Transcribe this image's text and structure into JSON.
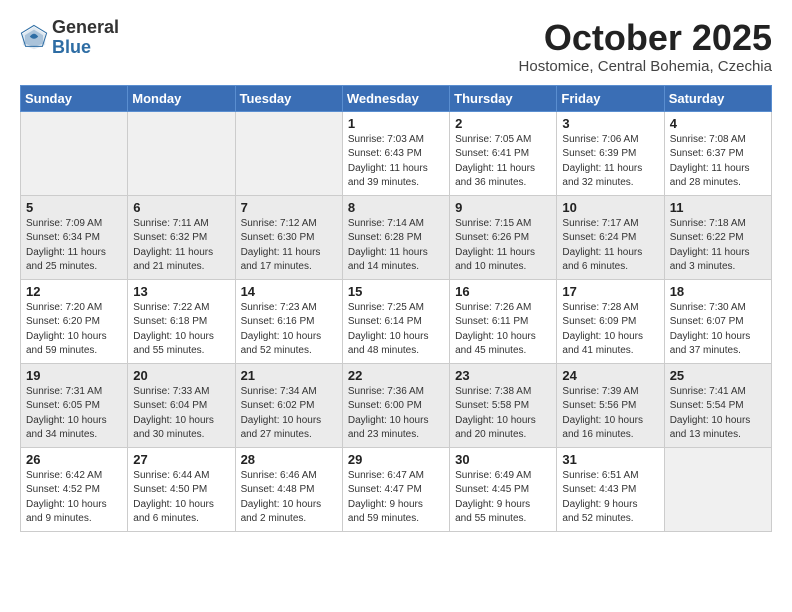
{
  "logo": {
    "general": "General",
    "blue": "Blue"
  },
  "title": "October 2025",
  "location": "Hostomice, Central Bohemia, Czechia",
  "days_header": [
    "Sunday",
    "Monday",
    "Tuesday",
    "Wednesday",
    "Thursday",
    "Friday",
    "Saturday"
  ],
  "weeks": [
    [
      {
        "day": "",
        "info": ""
      },
      {
        "day": "",
        "info": ""
      },
      {
        "day": "",
        "info": ""
      },
      {
        "day": "1",
        "info": "Sunrise: 7:03 AM\nSunset: 6:43 PM\nDaylight: 11 hours\nand 39 minutes."
      },
      {
        "day": "2",
        "info": "Sunrise: 7:05 AM\nSunset: 6:41 PM\nDaylight: 11 hours\nand 36 minutes."
      },
      {
        "day": "3",
        "info": "Sunrise: 7:06 AM\nSunset: 6:39 PM\nDaylight: 11 hours\nand 32 minutes."
      },
      {
        "day": "4",
        "info": "Sunrise: 7:08 AM\nSunset: 6:37 PM\nDaylight: 11 hours\nand 28 minutes."
      }
    ],
    [
      {
        "day": "5",
        "info": "Sunrise: 7:09 AM\nSunset: 6:34 PM\nDaylight: 11 hours\nand 25 minutes."
      },
      {
        "day": "6",
        "info": "Sunrise: 7:11 AM\nSunset: 6:32 PM\nDaylight: 11 hours\nand 21 minutes."
      },
      {
        "day": "7",
        "info": "Sunrise: 7:12 AM\nSunset: 6:30 PM\nDaylight: 11 hours\nand 17 minutes."
      },
      {
        "day": "8",
        "info": "Sunrise: 7:14 AM\nSunset: 6:28 PM\nDaylight: 11 hours\nand 14 minutes."
      },
      {
        "day": "9",
        "info": "Sunrise: 7:15 AM\nSunset: 6:26 PM\nDaylight: 11 hours\nand 10 minutes."
      },
      {
        "day": "10",
        "info": "Sunrise: 7:17 AM\nSunset: 6:24 PM\nDaylight: 11 hours\nand 6 minutes."
      },
      {
        "day": "11",
        "info": "Sunrise: 7:18 AM\nSunset: 6:22 PM\nDaylight: 11 hours\nand 3 minutes."
      }
    ],
    [
      {
        "day": "12",
        "info": "Sunrise: 7:20 AM\nSunset: 6:20 PM\nDaylight: 10 hours\nand 59 minutes."
      },
      {
        "day": "13",
        "info": "Sunrise: 7:22 AM\nSunset: 6:18 PM\nDaylight: 10 hours\nand 55 minutes."
      },
      {
        "day": "14",
        "info": "Sunrise: 7:23 AM\nSunset: 6:16 PM\nDaylight: 10 hours\nand 52 minutes."
      },
      {
        "day": "15",
        "info": "Sunrise: 7:25 AM\nSunset: 6:14 PM\nDaylight: 10 hours\nand 48 minutes."
      },
      {
        "day": "16",
        "info": "Sunrise: 7:26 AM\nSunset: 6:11 PM\nDaylight: 10 hours\nand 45 minutes."
      },
      {
        "day": "17",
        "info": "Sunrise: 7:28 AM\nSunset: 6:09 PM\nDaylight: 10 hours\nand 41 minutes."
      },
      {
        "day": "18",
        "info": "Sunrise: 7:30 AM\nSunset: 6:07 PM\nDaylight: 10 hours\nand 37 minutes."
      }
    ],
    [
      {
        "day": "19",
        "info": "Sunrise: 7:31 AM\nSunset: 6:05 PM\nDaylight: 10 hours\nand 34 minutes."
      },
      {
        "day": "20",
        "info": "Sunrise: 7:33 AM\nSunset: 6:04 PM\nDaylight: 10 hours\nand 30 minutes."
      },
      {
        "day": "21",
        "info": "Sunrise: 7:34 AM\nSunset: 6:02 PM\nDaylight: 10 hours\nand 27 minutes."
      },
      {
        "day": "22",
        "info": "Sunrise: 7:36 AM\nSunset: 6:00 PM\nDaylight: 10 hours\nand 23 minutes."
      },
      {
        "day": "23",
        "info": "Sunrise: 7:38 AM\nSunset: 5:58 PM\nDaylight: 10 hours\nand 20 minutes."
      },
      {
        "day": "24",
        "info": "Sunrise: 7:39 AM\nSunset: 5:56 PM\nDaylight: 10 hours\nand 16 minutes."
      },
      {
        "day": "25",
        "info": "Sunrise: 7:41 AM\nSunset: 5:54 PM\nDaylight: 10 hours\nand 13 minutes."
      }
    ],
    [
      {
        "day": "26",
        "info": "Sunrise: 6:42 AM\nSunset: 4:52 PM\nDaylight: 10 hours\nand 9 minutes."
      },
      {
        "day": "27",
        "info": "Sunrise: 6:44 AM\nSunset: 4:50 PM\nDaylight: 10 hours\nand 6 minutes."
      },
      {
        "day": "28",
        "info": "Sunrise: 6:46 AM\nSunset: 4:48 PM\nDaylight: 10 hours\nand 2 minutes."
      },
      {
        "day": "29",
        "info": "Sunrise: 6:47 AM\nSunset: 4:47 PM\nDaylight: 9 hours\nand 59 minutes."
      },
      {
        "day": "30",
        "info": "Sunrise: 6:49 AM\nSunset: 4:45 PM\nDaylight: 9 hours\nand 55 minutes."
      },
      {
        "day": "31",
        "info": "Sunrise: 6:51 AM\nSunset: 4:43 PM\nDaylight: 9 hours\nand 52 minutes."
      },
      {
        "day": "",
        "info": ""
      }
    ]
  ]
}
